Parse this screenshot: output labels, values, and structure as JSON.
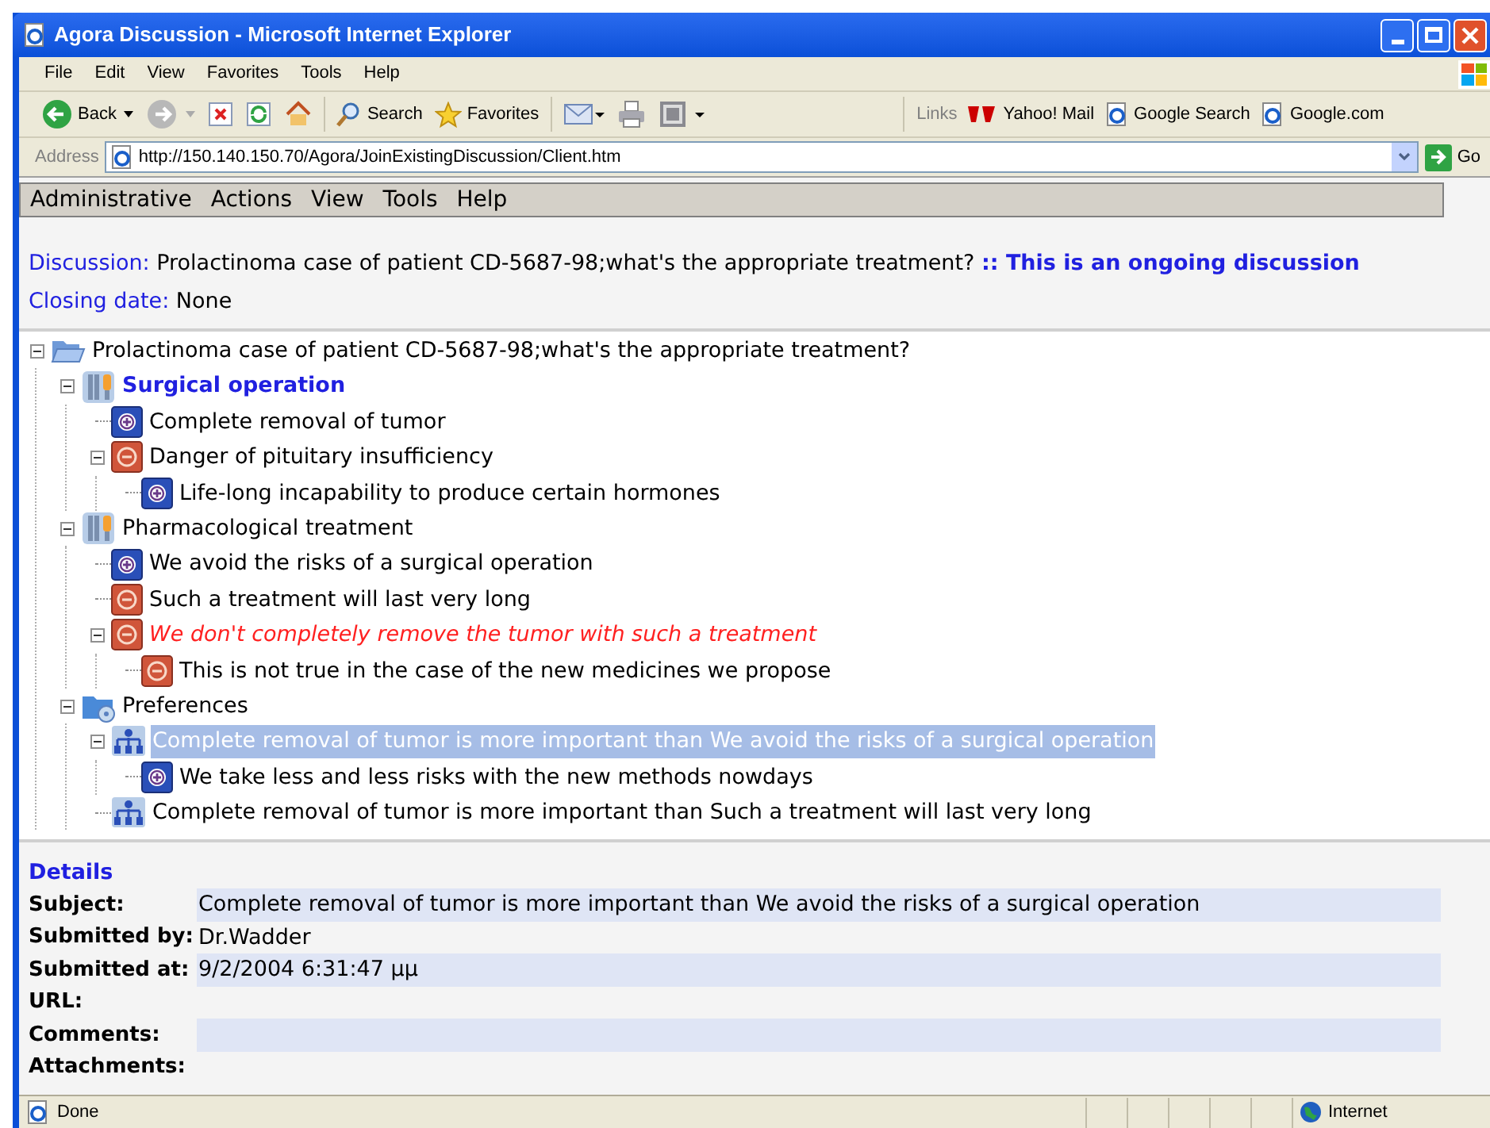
{
  "window": {
    "title": "Agora Discussion - Microsoft Internet Explorer"
  },
  "browser_menu": [
    "File",
    "Edit",
    "View",
    "Favorites",
    "Tools",
    "Help"
  ],
  "toolbar": [
    {
      "kind": "back",
      "label": "Back"
    },
    {
      "kind": "forward"
    },
    {
      "kind": "stop"
    },
    {
      "kind": "refresh"
    },
    {
      "kind": "home"
    },
    {
      "kind": "search",
      "label": "Search"
    },
    {
      "kind": "favorites",
      "label": "Favorites"
    },
    {
      "kind": "mail"
    },
    {
      "kind": "print"
    },
    {
      "kind": "edit"
    }
  ],
  "links": {
    "label": "Links",
    "items": [
      "Yahoo! Mail",
      "Google Search",
      "Google.com"
    ]
  },
  "address": {
    "label": "Address",
    "value": "http://150.140.150.70/Agora/JoinExistingDiscussion/Client.htm",
    "go": "Go"
  },
  "app_menu": [
    "Administrative",
    "Actions",
    "View",
    "Tools",
    "Help"
  ],
  "discussion": {
    "label": "Discussion:",
    "value": "Prolactinoma case of patient CD-5687-98;what's the appropriate treatment?",
    "separator": "::",
    "status": "This is an ongoing discussion"
  },
  "closing_date": {
    "label": "Closing date:",
    "value": "None"
  },
  "tree": [
    {
      "kind": "root",
      "text": "Prolactinoma case of patient CD-5687-98;what's the appropriate treatment?",
      "selected": false,
      "expanded": true,
      "children": [
        {
          "kind": "issue",
          "text": "Surgical operation",
          "preferred": true,
          "selected": false,
          "expanded": true,
          "children": [
            {
              "kind": "pro",
              "text": "Complete removal of tumor",
              "selected": false
            },
            {
              "kind": "con",
              "text": "Danger of pituitary insufficiency",
              "selected": false,
              "expanded": true,
              "children": [
                {
                  "kind": "pro",
                  "text": "Life-long incapability to produce certain hormones",
                  "selected": false
                }
              ]
            }
          ]
        },
        {
          "kind": "issue",
          "text": "Pharmacological treatment",
          "preferred": false,
          "selected": false,
          "expanded": true,
          "children": [
            {
              "kind": "pro",
              "text": "We avoid the risks of a surgical operation",
              "selected": false
            },
            {
              "kind": "con",
              "text": "Such a treatment will last very long",
              "selected": false
            },
            {
              "kind": "con",
              "text": "We don't completely remove the tumor with such a treatment",
              "defeated": true,
              "selected": false,
              "expanded": true,
              "children": [
                {
                  "kind": "con",
                  "text": "This is not true in the case of the new medicines we propose",
                  "selected": false
                }
              ]
            }
          ]
        },
        {
          "kind": "preferences",
          "text": "Preferences",
          "selected": false,
          "expanded": true,
          "children": [
            {
              "kind": "preference",
              "text": "Complete removal of tumor is more important than We avoid the risks of a surgical operation",
              "selected": true,
              "expanded": true,
              "children": [
                {
                  "kind": "pro",
                  "text": "We take less and less risks with the new methods nowdays",
                  "selected": false
                }
              ]
            },
            {
              "kind": "preference",
              "text": "Complete removal of tumor is more important than Such a treatment will last very long",
              "selected": false
            }
          ]
        }
      ]
    }
  ],
  "details": {
    "title": "Details",
    "rows": [
      {
        "label": "Subject:",
        "value": "Complete removal of tumor is more important than We avoid the risks of a surgical operation"
      },
      {
        "label": "Submitted by:",
        "value": "Dr.Wadder"
      },
      {
        "label": "Submitted at:",
        "value": "9/2/2004 6:31:47 μμ"
      },
      {
        "label": "URL:"
      },
      {
        "label": "Comments:"
      },
      {
        "label": "Attachments:"
      }
    ]
  },
  "status_bar": {
    "text": "Done",
    "zone": "Internet"
  }
}
